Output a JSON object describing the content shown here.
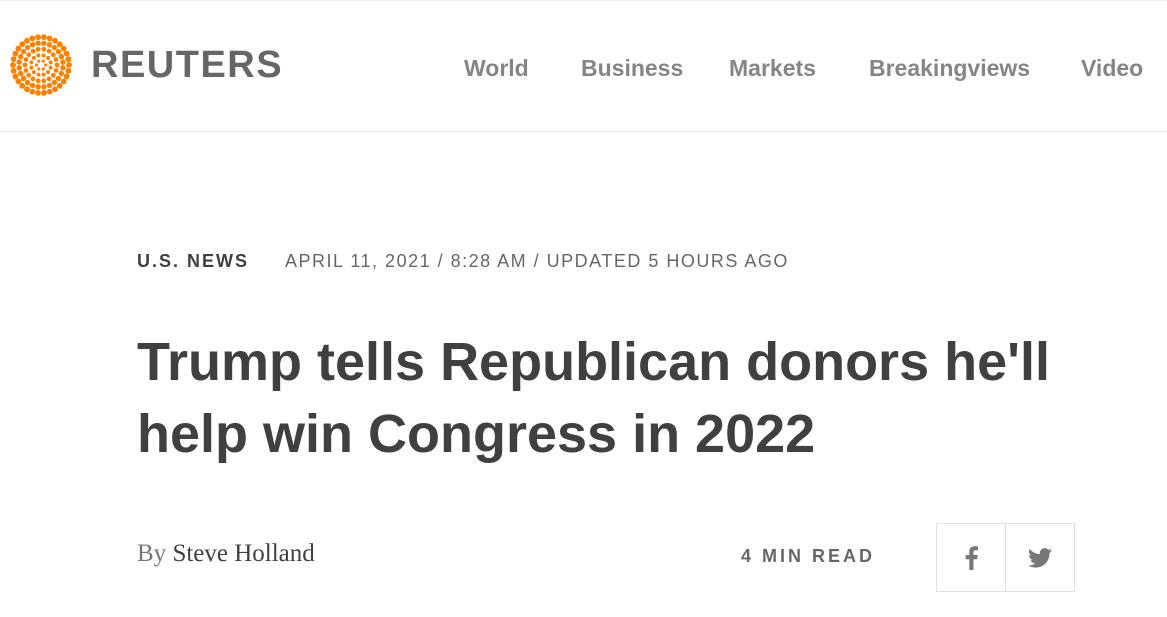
{
  "brand": {
    "name": "REUTERS",
    "logo_color": "#ff8000"
  },
  "nav": {
    "items": [
      {
        "label": "World"
      },
      {
        "label": "Business"
      },
      {
        "label": "Markets"
      },
      {
        "label": "Breakingviews"
      },
      {
        "label": "Video"
      }
    ]
  },
  "article": {
    "section": "U.S. NEWS",
    "dateline": "APRIL 11, 2021 / 8:28 AM / UPDATED 5 HOURS AGO",
    "headline": "Trump tells Republican donors he'll help win Congress in 2022",
    "byline_prefix": "By",
    "author": "Steve Holland",
    "read_time": "4 MIN READ"
  },
  "share": {
    "facebook_icon": "facebook-icon",
    "twitter_icon": "twitter-icon"
  },
  "colors": {
    "text_dark": "#404040",
    "text_mid": "#666666",
    "nav_text": "#858585",
    "icon": "#777777",
    "border": "#e0e0e0"
  }
}
